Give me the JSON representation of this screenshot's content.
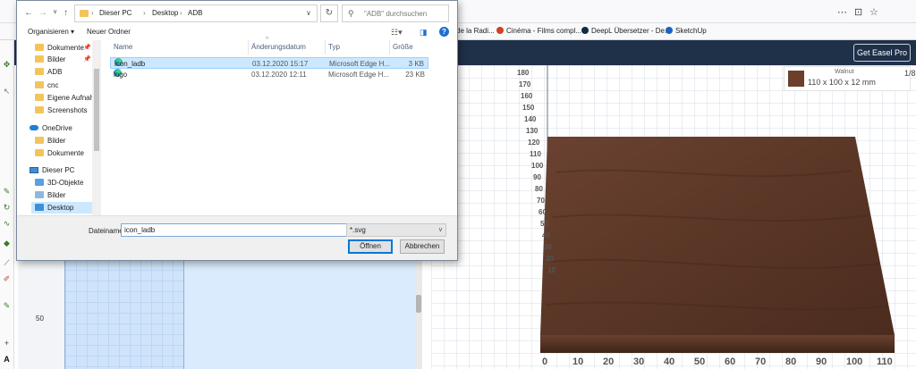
{
  "dialog": {
    "breadcrumb": [
      "Dieser PC",
      "Desktop",
      "ADB"
    ],
    "search_placeholder": "\"ADB\" durchsuchen",
    "toolbar": {
      "organize": "Organisieren ▾",
      "new_folder": "Neuer Ordner",
      "view_icon": "view-options-icon"
    },
    "nav": [
      {
        "label": "Dokumente",
        "icon": "folder",
        "pinned": true
      },
      {
        "label": "Bilder",
        "icon": "folder",
        "pinned": true
      },
      {
        "label": "ADB",
        "icon": "folder"
      },
      {
        "label": "cnc",
        "icon": "folder"
      },
      {
        "label": "Eigene Aufnahm",
        "icon": "folder"
      },
      {
        "label": "Screenshots",
        "icon": "folder"
      },
      {
        "label": "OneDrive",
        "icon": "cloud"
      },
      {
        "label": "Bilder",
        "icon": "folder"
      },
      {
        "label": "Dokumente",
        "icon": "folder"
      },
      {
        "label": "Dieser PC",
        "icon": "pc"
      },
      {
        "label": "3D-Objekte",
        "icon": "folder"
      },
      {
        "label": "Bilder",
        "icon": "folder"
      },
      {
        "label": "Desktop",
        "icon": "folder",
        "selected": true
      }
    ],
    "columns": {
      "name": "Name",
      "date": "Änderungsdatum",
      "type": "Typ",
      "size": "Größe"
    },
    "files": [
      {
        "name": "icon_ladb",
        "date": "03.12.2020 15:17",
        "type": "Microsoft Edge H...",
        "size": "3 KB",
        "selected": true
      },
      {
        "name": "logo",
        "date": "03.12.2020 12:11",
        "type": "Microsoft Edge H...",
        "size": "23 KB"
      }
    ],
    "filename_label": "Dateiname:",
    "filename_value": "icon_ladb",
    "filetype": "*.svg",
    "open_button": "Öffnen",
    "cancel_button": "Abbrechen"
  },
  "bookmarks": [
    {
      "label": "de la Radi...",
      "color": "#888888"
    },
    {
      "label": "Cinéma - Films compl...",
      "color": "#d04020"
    },
    {
      "label": "DeepL Übersetzer - De...",
      "color": "#0f2b46"
    },
    {
      "label": "SketchUp",
      "color": "#1a63c6"
    }
  ],
  "app": {
    "pro_button": "Get Easel Pro",
    "material_name": "Walnut",
    "material_dims": "110 x 100 x 12 mm",
    "bits_label": "1/8",
    "ruler_label": "50",
    "y_axis": [
      "180",
      "170",
      "160",
      "150",
      "140",
      "130",
      "120",
      "110",
      "100",
      "90",
      "80",
      "70",
      "60",
      "50",
      "40",
      "30",
      "20",
      "10"
    ],
    "x_axis": [
      "0",
      "10",
      "20",
      "30",
      "40",
      "50",
      "60",
      "70",
      "80",
      "90",
      "100",
      "110"
    ]
  },
  "colors": {
    "header": "#1f3049",
    "selection": "#cce8ff",
    "wood": "#5a3626"
  }
}
